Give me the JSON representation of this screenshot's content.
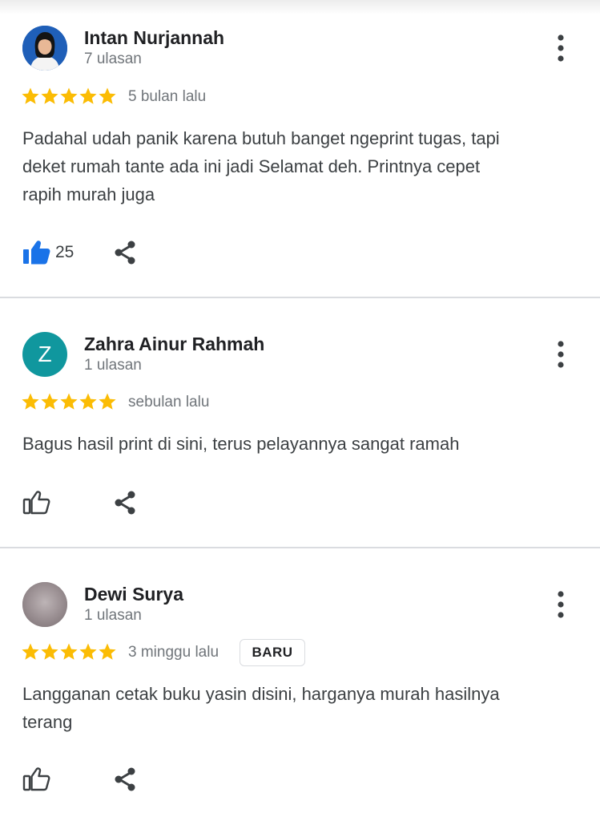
{
  "colors": {
    "star": "#fbbc04",
    "like_active": "#1a73e8",
    "teal_avatar": "#10979e",
    "divider": "#dadce0"
  },
  "reviews": [
    {
      "name": "Intan Nurjannah",
      "review_count": "7 ulasan",
      "rating": 5,
      "date": "5 bulan lalu",
      "text_lines": [
        "Padahal udah panik karena butuh banget ngeprint tugas, tapi",
        "deket rumah tante ada ini jadi Selamat deh. Printnya cepet",
        "rapih murah juga"
      ],
      "likes": "25",
      "avatar": "photo-icon"
    },
    {
      "name": "Zahra Ainur Rahmah",
      "review_count": "1 ulasan",
      "rating": 5,
      "date": "sebulan lalu",
      "text_lines": [
        "Bagus hasil print di sini, terus pelayannya sangat ramah"
      ],
      "avatar_letter": "Z"
    },
    {
      "name": "Dewi Surya",
      "review_count": "1 ulasan",
      "rating": 5,
      "date": "3 minggu lalu",
      "badge": "BARU",
      "text_lines": [
        "Langganan cetak buku yasin disini, harganya murah hasilnya",
        "terang"
      ],
      "avatar": "blurred-photo-icon"
    }
  ],
  "icons": {
    "more": "more-vertical-icon",
    "like": "thumbs-up-icon",
    "share": "share-icon",
    "star": "star-icon"
  }
}
